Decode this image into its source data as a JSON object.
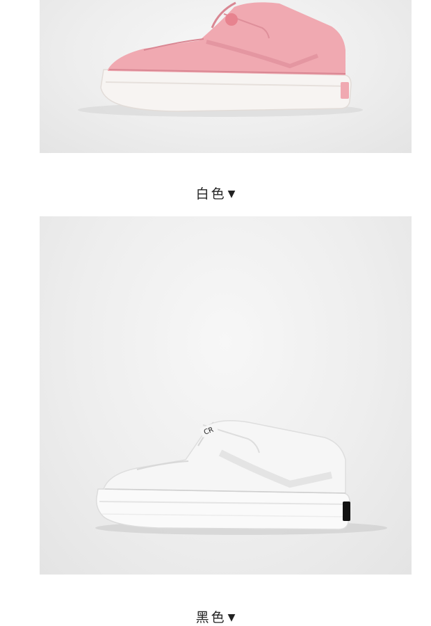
{
  "products": [
    {
      "caption": "白色",
      "arrow": "▼",
      "image_subject": "pink-sneaker",
      "upper_color": "#f0a9b1",
      "sole_color": "#f7f4f2"
    },
    {
      "caption": "黑色",
      "arrow": "▼",
      "image_subject": "white-sneaker",
      "upper_color": "#f6f6f6",
      "sole_color": "#fafafa"
    }
  ]
}
